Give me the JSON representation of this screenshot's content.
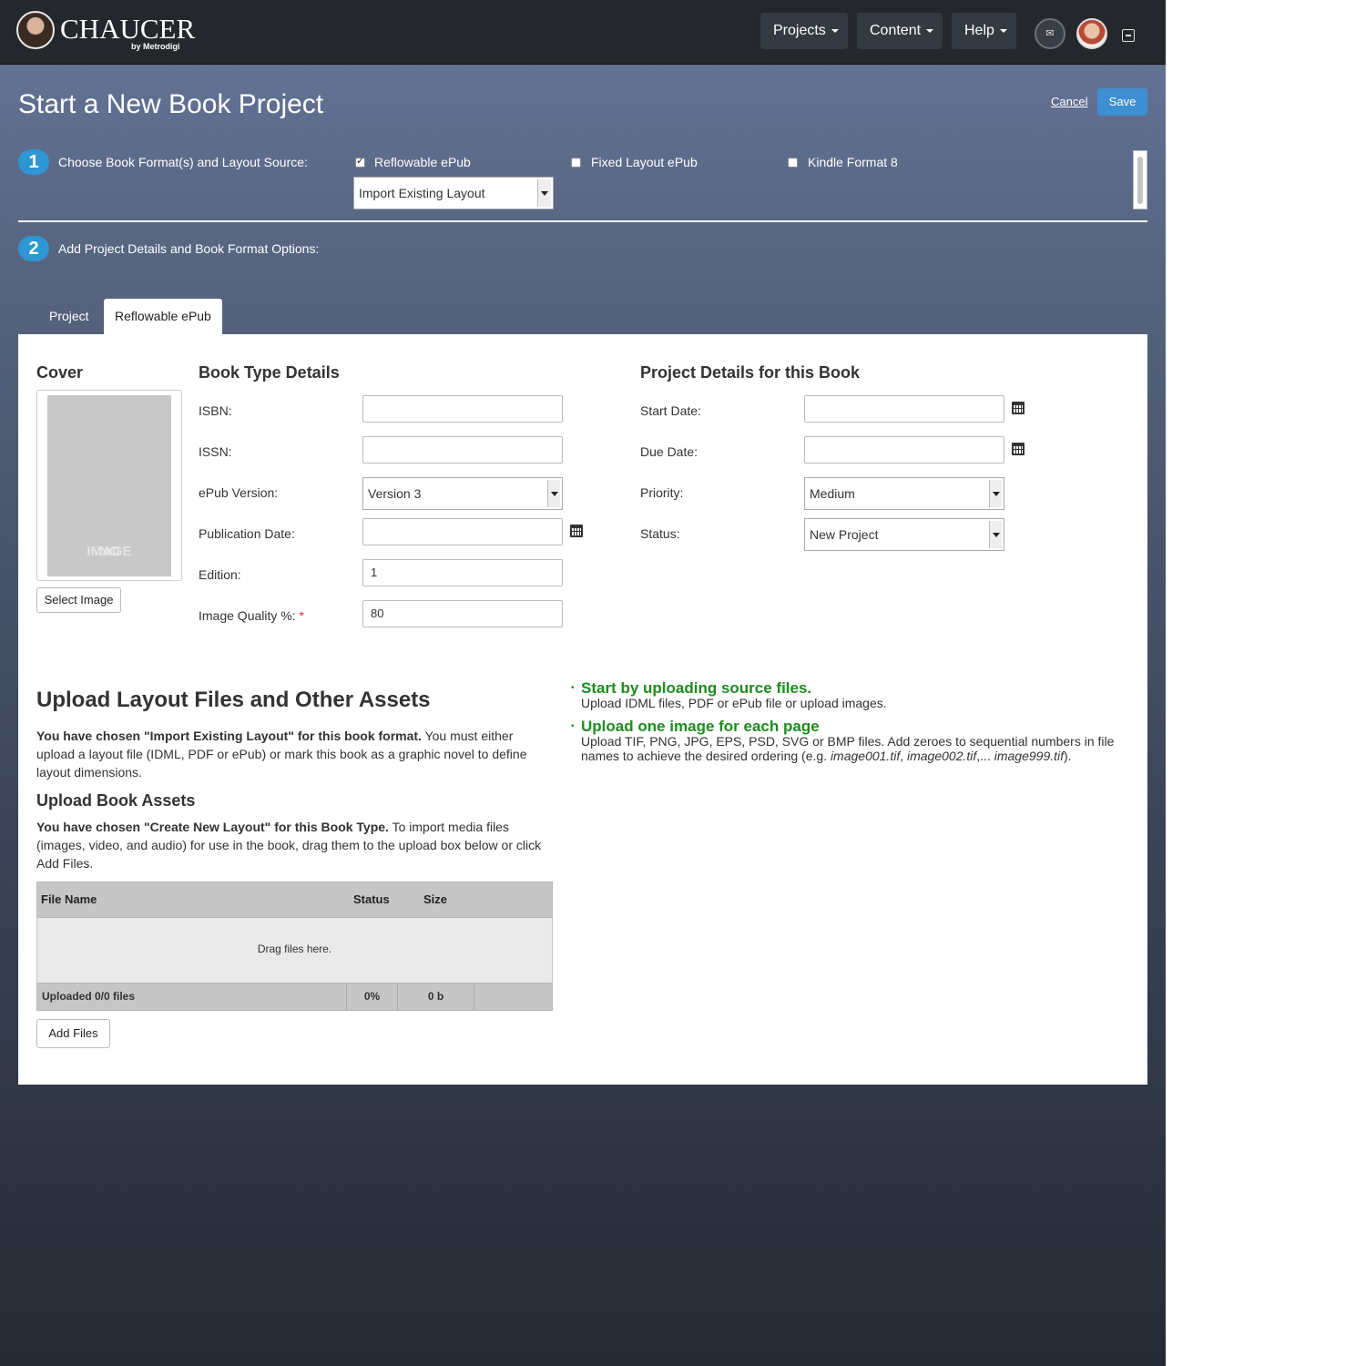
{
  "navbar": {
    "logo_text": "CHAUCER",
    "logo_sub": "by Metrodigi",
    "menus": [
      "Projects",
      "Content",
      "Help"
    ]
  },
  "page": {
    "title": "Start a New Book Project",
    "cancel_label": "Cancel",
    "save_label": "Save"
  },
  "step1": {
    "number": "1",
    "label": "Choose Book Format(s) and Layout Source:",
    "formats": [
      {
        "label": "Reflowable ePub",
        "checked": true
      },
      {
        "label": "Fixed Layout ePub",
        "checked": false
      },
      {
        "label": "Kindle Format 8",
        "checked": false
      }
    ],
    "layout_source": "Import Existing Layout"
  },
  "step2": {
    "number": "2",
    "label": "Add Project Details and Book Format Options:"
  },
  "tabs": [
    {
      "label": "Project",
      "active": false
    },
    {
      "label": "Reflowable ePub",
      "active": true
    }
  ],
  "cover": {
    "heading": "Cover",
    "placeholder_line1": "NO",
    "placeholder_line2": "IMAGE",
    "select_button": "Select Image"
  },
  "book_type": {
    "heading": "Book Type Details",
    "fields": [
      {
        "label": "ISBN:",
        "value": ""
      },
      {
        "label": "ISSN:",
        "value": ""
      },
      {
        "label": "ePub Version:",
        "value": "Version 3"
      },
      {
        "label": "Publication Date:",
        "value": ""
      },
      {
        "label": "Edition:",
        "value": "1"
      },
      {
        "label": "Image Quality %:",
        "value": "80",
        "required_mark": "*"
      }
    ]
  },
  "project_details": {
    "heading": "Project Details for this Book",
    "fields": [
      {
        "label": "Start Date:",
        "value": ""
      },
      {
        "label": "Due Date:",
        "value": ""
      },
      {
        "label": "Priority:",
        "value": "Medium"
      },
      {
        "label": "Status:",
        "value": "New Project"
      }
    ]
  },
  "upload": {
    "heading": "Upload Layout Files and Other Assets",
    "para1_bold": "You have chosen \"Import Existing Layout\" for this book format.",
    "para1_rest": " You must either upload a layout file (IDML, PDF or ePub) or mark this book as a graphic novel to define layout dimensions.",
    "assets_heading": "Upload Book Assets",
    "para2_bold": "You have chosen \"Create New Layout\" for this Book Type.",
    "para2_rest": " To import media files (images, video, and audio) for use in the book, drag them to the upload box below or click Add Files.",
    "table": {
      "columns": [
        "File Name",
        "Status",
        "Size"
      ],
      "drop_text": "Drag files here.",
      "footer_files": "Uploaded 0/0 files",
      "footer_percent": "0%",
      "footer_size": "0 b"
    },
    "add_button": "Add Files"
  },
  "hints": [
    {
      "title": "Start by uploading source files.",
      "desc": "Upload IDML files, PDF or ePub file or upload images."
    },
    {
      "title": "Upload one image for each page",
      "desc_prefix": "Upload TIF, PNG, JPG, EPS, PSD, SVG or BMP files. Add zeroes to sequential numbers in file names to achieve the desired ordering (e.g. ",
      "ex1": "image001.tif",
      "sep1": ", ",
      "ex2": "image002.tif",
      "sep2": ",... ",
      "ex3": "image999.tif",
      "desc_suffix": ")."
    }
  ],
  "colors": {
    "accent_blue": "#2e96d2",
    "save_blue": "#3d8fd1",
    "hint_green": "#1e8c1e",
    "navbar": "#24282d"
  }
}
